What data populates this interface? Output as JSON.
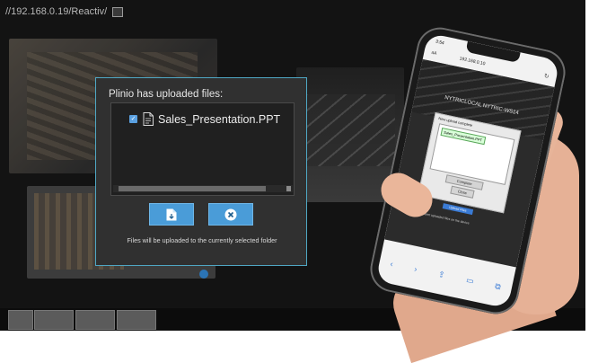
{
  "browser": {
    "url": "//192.168.0.19/Reactiv/"
  },
  "dialog": {
    "title": "Plinio has uploaded files:",
    "files": [
      {
        "name": "Sales_Presentation.PPT",
        "checked": true,
        "icon": "document-icon"
      }
    ],
    "buttons": {
      "download_icon": "download-file-icon",
      "cancel_icon": "close-circle-icon"
    },
    "note": "Files will be uploaded to the currently selected folder",
    "accent_color": "#4a9cd8",
    "border_color": "#4fa7c4"
  },
  "phone": {
    "status_time": "3:54",
    "address": "192.168.0.10",
    "aa_label": "aA",
    "app_title": "NYTRICLOCAL NYTRIC-WS14",
    "dialog_title": "New upload complete",
    "file_item": "Sales_Presentation.PPT",
    "complete_label": "Complete",
    "close_label": "Close",
    "upload_button": "Upload Files",
    "note_prefix": "Note:",
    "note_text": "View and present uploaded files on the device",
    "toolbar_icons": [
      "back-icon",
      "forward-icon",
      "share-icon",
      "bookmarks-icon",
      "tabs-icon"
    ]
  }
}
